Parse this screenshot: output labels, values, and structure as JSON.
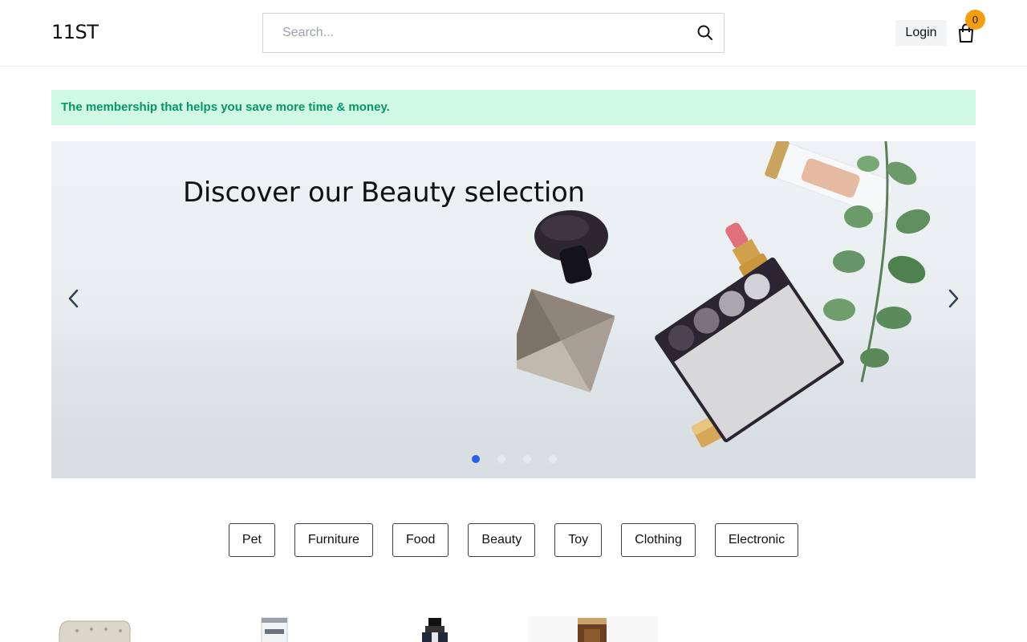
{
  "header": {
    "logo": "11ST",
    "search_placeholder": "Search...",
    "login_label": "Login",
    "cart_count": "0"
  },
  "promo": {
    "text": "The membership that helps you save more time & money."
  },
  "hero": {
    "title": "Discover our Beauty selection",
    "slide_count": 4,
    "active_slide": 1
  },
  "categories": [
    "Pet",
    "Furniture",
    "Food",
    "Beauty",
    "Toy",
    "Clothing",
    "Electronic"
  ],
  "colors": {
    "badge": "#f59e0b",
    "promo_bg": "#d1fae5",
    "promo_text": "#059669",
    "active_dot": "#2563eb"
  },
  "icons": {
    "search": "search-icon",
    "cart": "shopping-bag-icon",
    "prev": "chevron-left-icon",
    "next": "chevron-right-icon"
  }
}
